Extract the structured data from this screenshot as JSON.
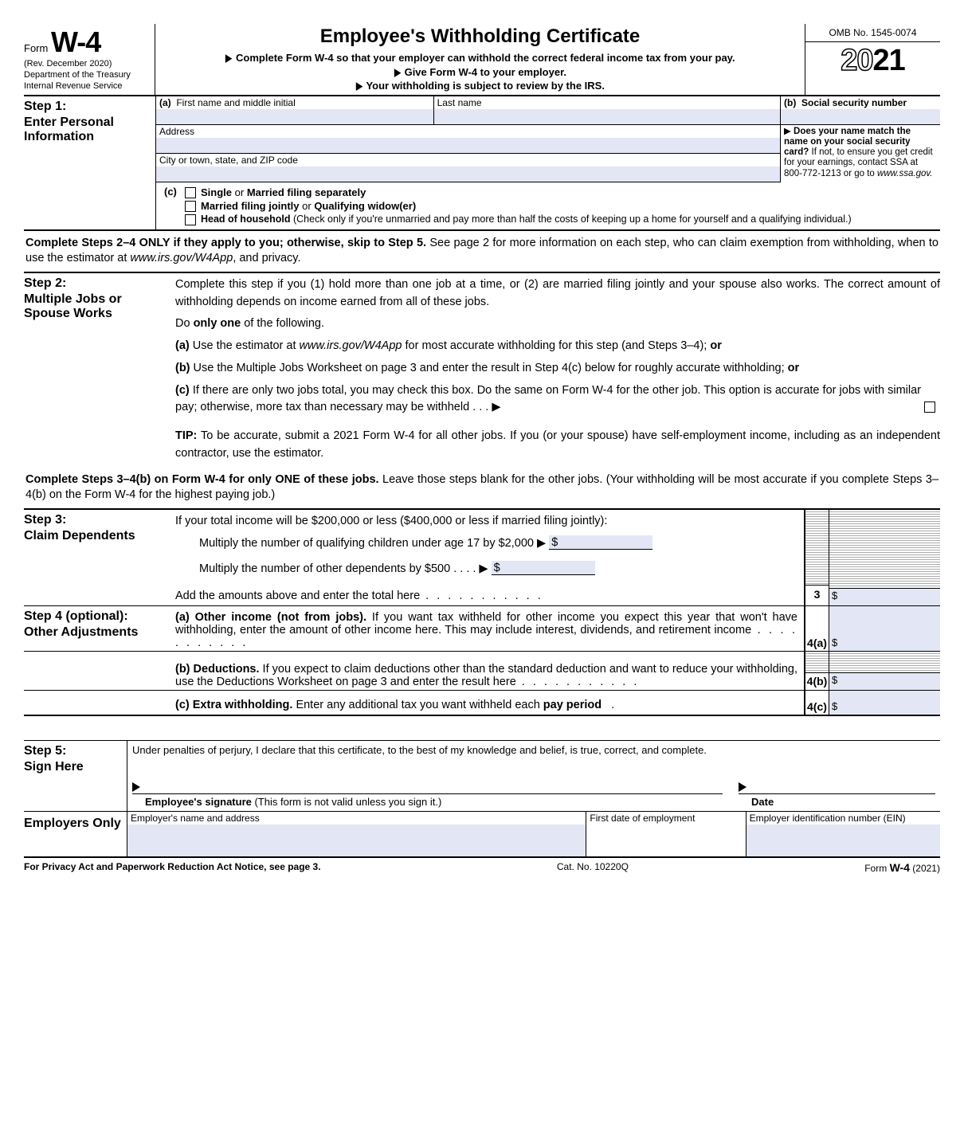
{
  "header": {
    "form_word": "Form",
    "form_no": "W-4",
    "revision": "(Rev. December 2020)",
    "dept1": "Department of the Treasury",
    "dept2": "Internal Revenue Service",
    "title": "Employee's Withholding Certificate",
    "sub1": "Complete Form W-4 so that your employer can withhold the correct federal income tax from your pay.",
    "sub2": "Give Form W-4 to your employer.",
    "sub3": "Your withholding is subject to review by the IRS.",
    "omb": "OMB No. 1545-0074",
    "year_outline": "20",
    "year_solid": "21"
  },
  "step1": {
    "title": "Step 1:",
    "sub": "Enter Personal Information",
    "a_label": "(a)",
    "first_name": "First name and middle initial",
    "last_name": "Last name",
    "address": "Address",
    "city": "City or town, state, and ZIP code",
    "b_label": "(b)",
    "ssn": "Social security number",
    "name_match": "Does your name match the name on your social security card?",
    "name_match2": " If not, to ensure you get credit for your earnings, contact SSA at 800-772-1213 or go to ",
    "ssa_site": "www.ssa.gov.",
    "c_label": "(c)",
    "filing1a": "Single",
    "filing1b": " or ",
    "filing1c": "Married filing separately",
    "filing2a": "Married filing jointly",
    "filing2b": " or ",
    "filing2c": "Qualifying widow(er)",
    "filing3a": "Head of household",
    "filing3b": " (Check only if you're unmarried and pay more than half the costs of keeping up a home for yourself and a qualifying individual.)"
  },
  "mid1a": "Complete Steps 2–4 ONLY if they apply to you; otherwise, skip to Step 5.",
  "mid1b": " See page 2 for more information on each step, who can claim exemption from withholding, when to use the estimator at ",
  "mid1c": "www.irs.gov/W4App",
  "mid1d": ", and privacy.",
  "step2": {
    "title": "Step 2:",
    "sub": "Multiple Jobs or Spouse Works",
    "intro": "Complete this step if you (1) hold more than one job at a time, or (2) are married filing jointly and your spouse also works. The correct amount of withholding depends on income earned from all of these jobs.",
    "do_one_a": "Do ",
    "do_one_b": "only one",
    "do_one_c": " of the following.",
    "a_pre": "(a) ",
    "a_1": "Use the estimator at ",
    "a_site": "www.irs.gov/W4App",
    "a_2": " for most accurate withholding for this step (and Steps 3–4); ",
    "a_or": "or",
    "b_pre": "(b) ",
    "b_1": "Use the Multiple Jobs Worksheet on page 3 and enter the result in Step 4(c) below for roughly accurate withholding; ",
    "b_or": "or",
    "c_pre": "(c) ",
    "c_1": "If there are only two jobs total, you may check this box. Do the same on Form W-4 for the other job. This option is accurate for jobs with similar pay; otherwise, more tax than necessary may be withheld   .    .    .   ▶",
    "tip_a": "TIP:",
    "tip_b": " To be accurate, submit a 2021 Form W-4 for all other jobs. If you (or your spouse) have self-employment income, including as an independent contractor, use the estimator."
  },
  "mid2a": "Complete Steps 3–4(b) on Form W-4 for only ONE of these jobs.",
  "mid2b": " Leave those steps blank for the other jobs. (Your withholding will be most accurate if you complete Steps 3–4(b) on the Form W-4 for the highest paying job.)",
  "step3": {
    "title": "Step 3:",
    "sub": "Claim Dependents",
    "intro": "If your total income will be $200,000 or less ($400,000 or less if married filing jointly):",
    "line1": "Multiply the number of qualifying children under age 17 by $2,000 ▶",
    "line2": "Multiply the number of other dependents by $500    .    .    .    .   ▶",
    "total": "Add the amounts above and enter the total here",
    "num": "3",
    "ds": "$"
  },
  "step4": {
    "title": "Step 4 (optional):",
    "sub": "Other Adjustments",
    "a_pre": "(a) ",
    "a_b": "Other income (not from jobs).",
    "a_t": " If you want tax withheld for other income you expect this year that won't have withholding, enter the amount of other income here. This may include interest, dividends, and retirement income",
    "a_num": "4(a)",
    "b_pre": "(b) ",
    "b_b": "Deductions.",
    "b_t": " If you expect to claim deductions other than the standard deduction and want to reduce your withholding, use the Deductions Worksheet on page 3 and enter the result here",
    "b_num": "4(b)",
    "c_pre": "(c) ",
    "c_b": "Extra withholding.",
    "c_t": " Enter any additional tax you want withheld each ",
    "c_b2": "pay period",
    "c_num": "4(c)",
    "ds": "$"
  },
  "step5": {
    "title": "Step 5:",
    "sub": "Sign Here",
    "declare": "Under penalties of perjury, I declare that this certificate, to the best of my knowledge and belief, is true, correct, and complete.",
    "sig_a": "Employee's signature",
    "sig_b": " (This form is not valid unless you sign it.)",
    "date": "Date"
  },
  "emp": {
    "title": "Employers Only",
    "name_addr": "Employer's name and address",
    "first_date": "First date of employment",
    "ein": "Employer identification number (EIN)"
  },
  "footer": {
    "left": "For Privacy Act and Paperwork Reduction Act Notice, see page 3.",
    "mid": "Cat. No. 10220Q",
    "right_a": "Form ",
    "right_b": "W-4",
    "right_c": " (2021)"
  }
}
